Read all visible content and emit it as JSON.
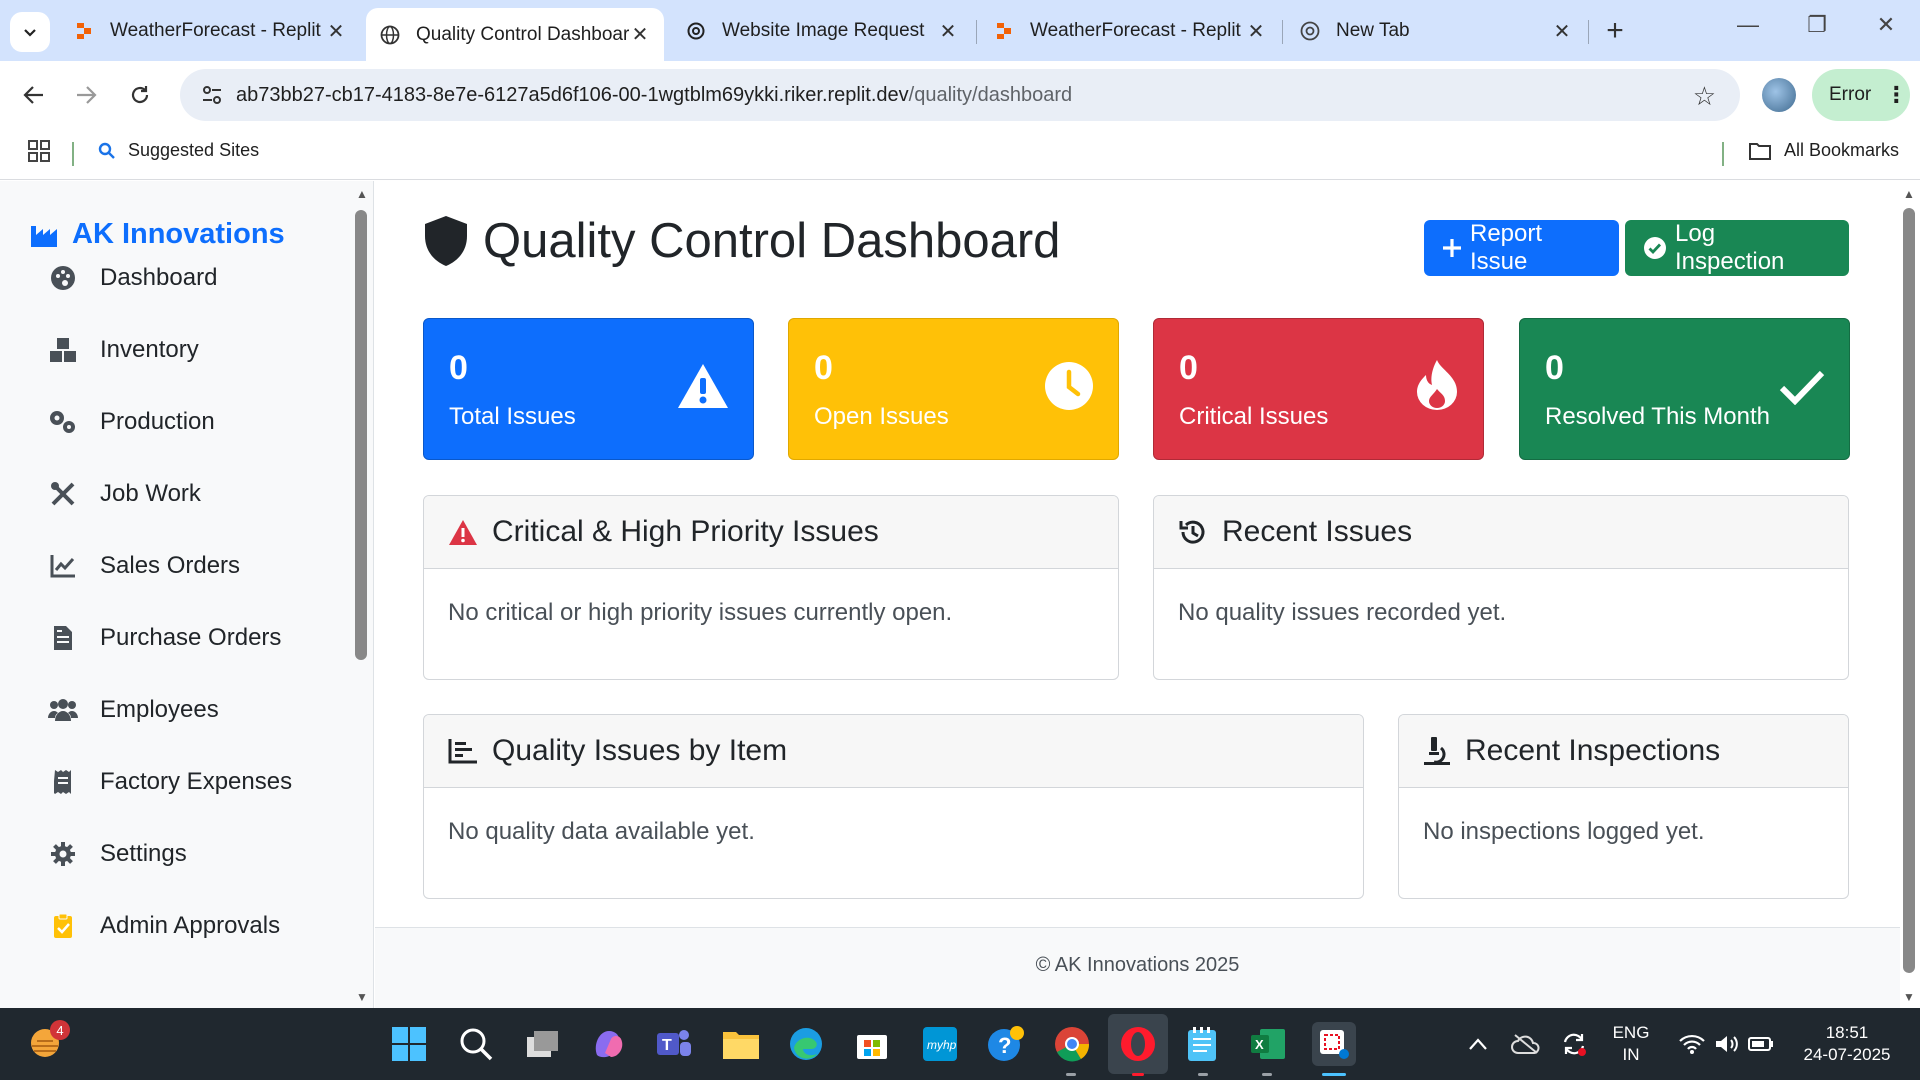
{
  "browser": {
    "tabs": [
      {
        "label": "WeatherForecast - Replit",
        "icon": "replit-icon"
      },
      {
        "label": "Quality Control Dashboard",
        "icon": "globe-icon",
        "active": true
      },
      {
        "label": "Website Image Request",
        "icon": "openai-icon"
      },
      {
        "label": "WeatherForecast - Replit",
        "icon": "replit-icon"
      },
      {
        "label": "New Tab",
        "icon": "chrome-icon"
      }
    ],
    "url_host": "ab73bb27-cb17-4183-8e7e-6127a5d6f106-00-1wgtblm69ykki.riker.replit.dev",
    "url_path": "/quality/dashboard",
    "profile_status": "Error",
    "bookmarks": {
      "suggested": "Suggested Sites",
      "all": "All Bookmarks"
    }
  },
  "sidebar": {
    "brand": "AK Innovations",
    "items": [
      {
        "label": "Dashboard",
        "icon": "palette-icon"
      },
      {
        "label": "Inventory",
        "icon": "boxes-icon"
      },
      {
        "label": "Production",
        "icon": "cogs-icon"
      },
      {
        "label": "Job Work",
        "icon": "tools-icon"
      },
      {
        "label": "Sales Orders",
        "icon": "chart-line-icon"
      },
      {
        "label": "Purchase Orders",
        "icon": "file-invoice-icon"
      },
      {
        "label": "Employees",
        "icon": "users-icon"
      },
      {
        "label": "Factory Expenses",
        "icon": "receipt-icon"
      },
      {
        "label": "Settings",
        "icon": "gear-icon"
      },
      {
        "label": "Admin Approvals",
        "icon": "clipboard-check-icon"
      }
    ]
  },
  "main": {
    "title": "Quality Control Dashboard",
    "actions": {
      "report": "Report Issue",
      "log": "Log Inspection"
    },
    "stats": [
      {
        "value": "0",
        "label": "Total Issues",
        "icon": "warning-icon",
        "color": "#0d6efd"
      },
      {
        "value": "0",
        "label": "Open Issues",
        "icon": "clock-icon",
        "color": "#ffc107"
      },
      {
        "value": "0",
        "label": "Critical Issues",
        "icon": "fire-icon",
        "color": "#dc3545"
      },
      {
        "value": "0",
        "label": "Resolved This Month",
        "icon": "check-icon",
        "color": "#198754"
      }
    ],
    "cards": {
      "critical": {
        "title": "Critical & High Priority Issues",
        "body": "No critical or high priority issues currently open."
      },
      "recent_issues": {
        "title": "Recent Issues",
        "body": "No quality issues recorded yet."
      },
      "by_item": {
        "title": "Quality Issues by Item",
        "body": "No quality data available yet."
      },
      "inspections": {
        "title": "Recent Inspections",
        "body": "No inspections logged yet."
      }
    },
    "footer": "© AK Innovations 2025"
  },
  "taskbar": {
    "widget_badge": "4",
    "lang": "ENG",
    "region": "IN",
    "time": "18:51",
    "date": "24-07-2025"
  }
}
